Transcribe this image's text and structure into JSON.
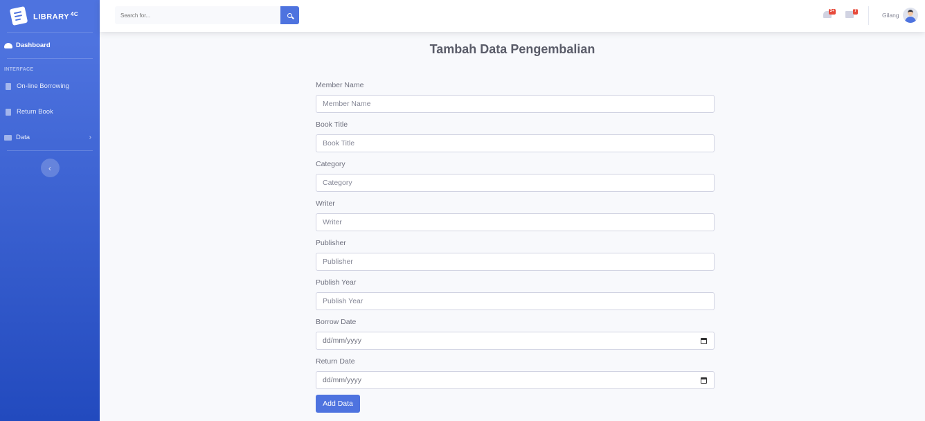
{
  "sidebar": {
    "brand": {
      "name": "LIBRARY",
      "sup": "4C"
    },
    "items": [
      {
        "label": "Dashboard",
        "icon": "tachometer-icon"
      },
      {
        "label": "On-line Borrowing",
        "icon": "book-icon"
      },
      {
        "label": "Return Book",
        "icon": "book-icon"
      },
      {
        "label": "Data",
        "icon": "folder-icon"
      }
    ],
    "heading": "INTERFACE"
  },
  "topbar": {
    "search_placeholder": "Search for...",
    "alerts_badge": "3+",
    "messages_badge": "7",
    "user_name": "Gilang"
  },
  "page": {
    "title": "Tambah Data Pengembalian",
    "fields": [
      {
        "label": "Member Name",
        "placeholder": "Member Name"
      },
      {
        "label": "Book Title",
        "placeholder": "Book Title"
      },
      {
        "label": "Category",
        "placeholder": "Category"
      },
      {
        "label": "Writer",
        "placeholder": "Writer"
      },
      {
        "label": "Publisher",
        "placeholder": "Publisher"
      },
      {
        "label": "Publish Year",
        "placeholder": "Publish Year"
      },
      {
        "label": "Borrow Date",
        "placeholder": "dd/mm/yyyy"
      },
      {
        "label": "Return Date",
        "placeholder": "dd/mm/yyyy"
      }
    ],
    "submit_label": "Add Data"
  },
  "colors": {
    "primary": "#4e73df",
    "badge": "#e74a3b"
  }
}
